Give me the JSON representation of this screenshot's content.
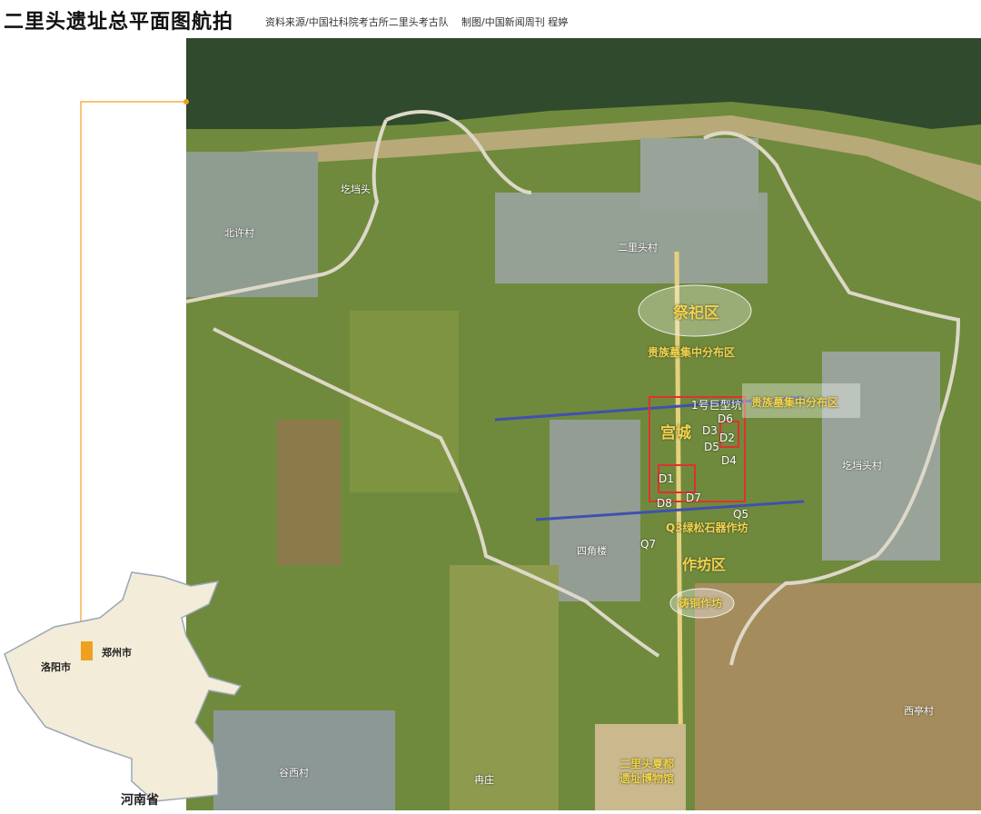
{
  "header": {
    "title": "二里头遗址总平面图航拍",
    "source": "资料来源/中国社科院考古所二里头考古队",
    "credit": "制图/中国新闻周刊  程婷"
  },
  "zones": {
    "sacrifice": "祭祀区",
    "noble_tombs_1": "贵族墓集中分布区",
    "noble_tombs_2": "贵族墓集中分布区",
    "palace": "宫城",
    "pit": "1号巨型坑",
    "workshop": "作坊区",
    "turquoise": "Q3绿松石器作坊",
    "bronze": "铸铜作坊",
    "museum_1": "二里头夏都",
    "museum_2": "遗址博物馆"
  },
  "points": [
    "D1",
    "D2",
    "D3",
    "D4",
    "D5",
    "D6",
    "D7",
    "D8",
    "Q5",
    "Q7"
  ],
  "villages": {
    "v1": "圪垱头",
    "v2": "北许村",
    "v3": "二里头村",
    "v4": "圪垱头村",
    "v5": "四角楼",
    "v6": "谷西村",
    "v7": "冉庄",
    "v8": "西亭村"
  },
  "inset": {
    "province": "河南省",
    "city1": "郑州市",
    "city2": "洛阳市"
  },
  "colors": {
    "accent": "#f0a020",
    "zone_text": "#f2d44a",
    "palace_line": "#e03030",
    "road_blue": "#4050b0"
  }
}
